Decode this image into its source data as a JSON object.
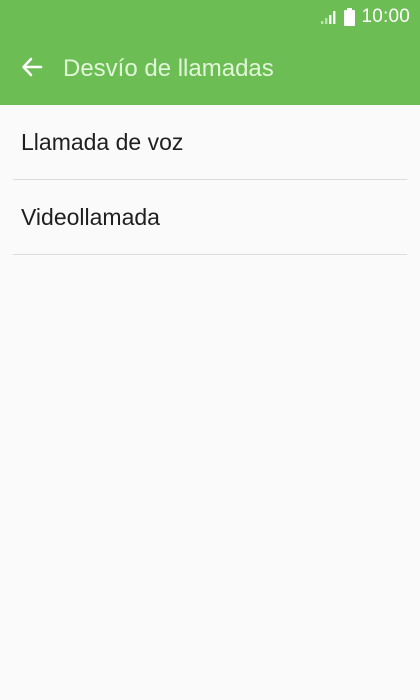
{
  "status_bar": {
    "time": "10:00",
    "icons": [
      "signal-icon",
      "battery-icon"
    ]
  },
  "header": {
    "back_icon": "arrow-left-icon",
    "title": "Desvío de llamadas"
  },
  "colors": {
    "header_background": "#6cbd54",
    "title_text": "#e2f6d9",
    "page_background": "#fafafa",
    "divider": "#dcdcdc"
  },
  "list": {
    "items": [
      {
        "label": "Llamada de voz"
      },
      {
        "label": "Videollamada"
      }
    ]
  }
}
